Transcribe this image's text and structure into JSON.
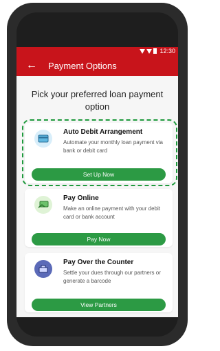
{
  "status": {
    "time": "12:30"
  },
  "appbar": {
    "title": "Payment Options",
    "back_icon": "arrow-left-icon"
  },
  "heading": "Pick your preferred loan payment option",
  "options": [
    {
      "title": "Auto Debit Arrangement",
      "description": "Automate your monthly loan payment via bank or debit card",
      "button": "Set Up Now",
      "icon": "card-icon"
    },
    {
      "title": "Pay Online",
      "description": "Make an online payment with your debit card or bank account",
      "button": "Pay Now",
      "icon": "card-hand-icon"
    },
    {
      "title": "Pay Over the Counter",
      "description": "Settle your dues through our partners or generate a barcode",
      "button": "View Partners",
      "icon": "register-icon"
    }
  ],
  "colors": {
    "brand_red": "#c8141b",
    "green": "#2c9a44",
    "highlight_dash": "#1e9a3c"
  }
}
